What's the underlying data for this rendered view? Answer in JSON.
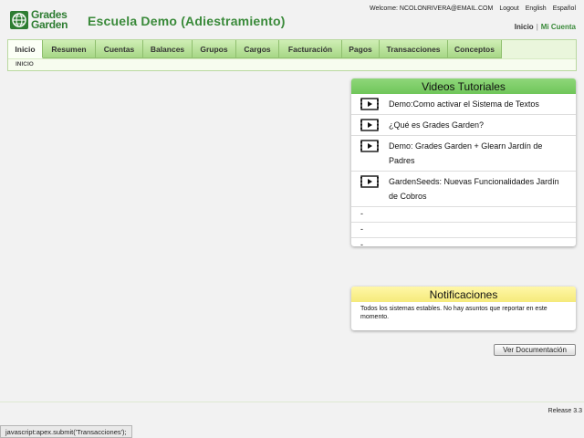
{
  "header": {
    "logo_line1": "Grades",
    "logo_line2": "Garden",
    "site_title": "Escuela Demo (Adiestramiento)",
    "welcome": "Welcome: NCOLONRIVERA@EMAIL.COM",
    "logout": "Logout",
    "english": "English",
    "espanol": "Español",
    "inicio_link": "Inicio",
    "separator": "|",
    "mi_cuenta": "Mi Cuenta"
  },
  "nav": {
    "tabs": [
      {
        "label": "Inicio",
        "active": true
      },
      {
        "label": "Resumen"
      },
      {
        "label": "Cuentas"
      },
      {
        "label": "Balances"
      },
      {
        "label": "Grupos"
      },
      {
        "label": "Cargos"
      },
      {
        "label": "Facturación"
      },
      {
        "label": "Pagos"
      },
      {
        "label": "Transacciones"
      },
      {
        "label": "Conceptos"
      }
    ],
    "breadcrumb": "INICIO"
  },
  "videos": {
    "title": "Videos Tutoriales",
    "items": [
      {
        "label": "Demo:Como activar el Sistema de Textos"
      },
      {
        "label": "¿Qué es Grades Garden?"
      },
      {
        "label": "Demo: Grades Garden + Glearn Jardín de Padres"
      },
      {
        "label": "GardenSeeds: Nuevas Funcionalidades Jardín de Cobros"
      },
      {
        "label": "-"
      },
      {
        "label": "-"
      },
      {
        "label": "-"
      }
    ]
  },
  "notifications": {
    "title": "Notificaciones",
    "message": "Todos los sistemas estables. No hay asuntos que reportar en este momento."
  },
  "doc_button": "Ver Documentación",
  "release": "Release 3.3",
  "status_bar": "javascript:apex.submit('Transacciones');",
  "colors": {
    "brand_green": "#3a8a3a",
    "tab_green": "#a7d786",
    "videos_header": "#7ccf66",
    "notifications_header": "#f8ee8c"
  }
}
